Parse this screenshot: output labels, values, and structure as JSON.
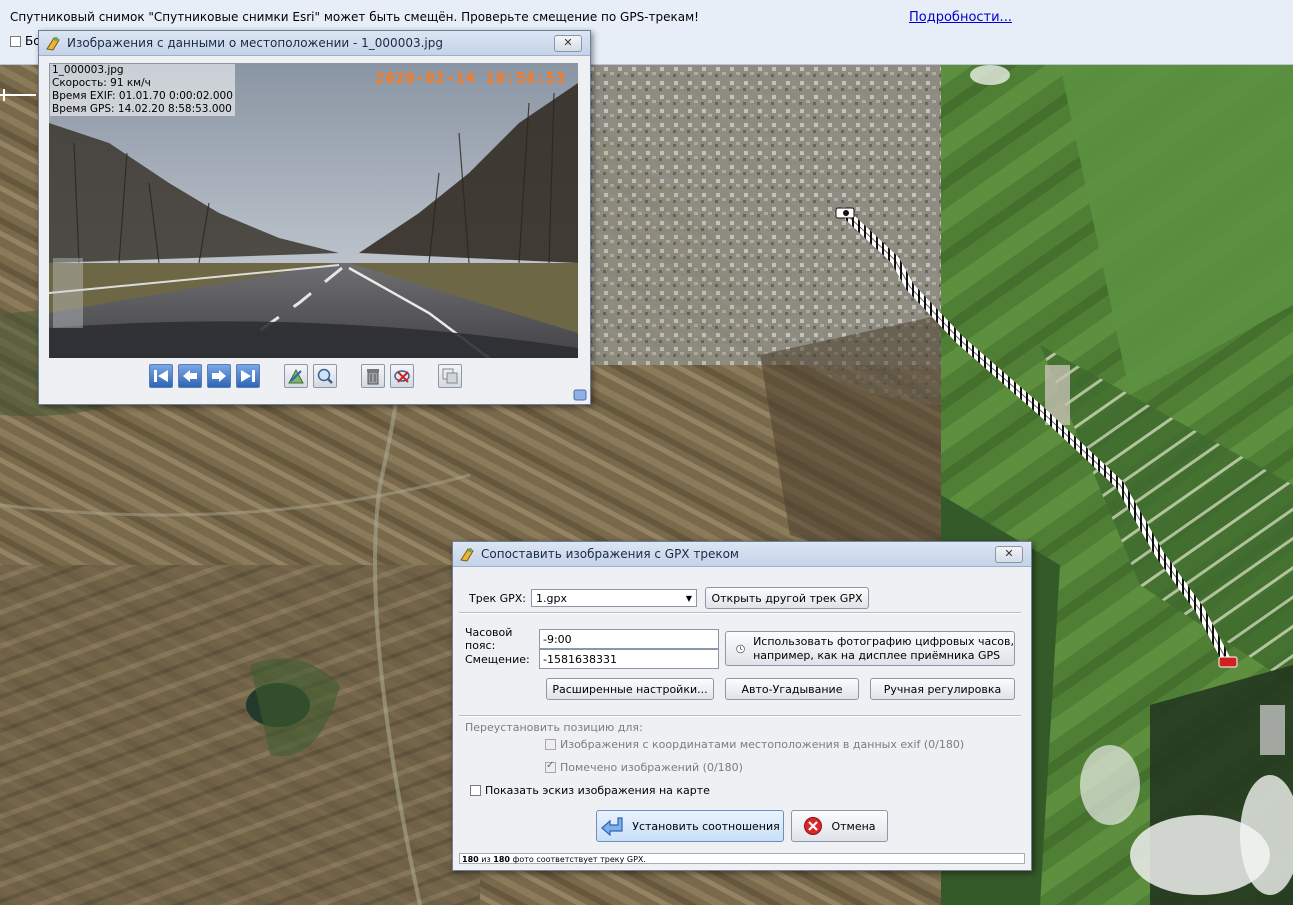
{
  "notice": {
    "message": "Спутниковый снимок \"Спутниковые снимки Esri\" может быть смещён. Проверьте смещение по GPS-трекам!",
    "link": "Подробности...",
    "checkbox_label": "Бо"
  },
  "viewer": {
    "title": "Изображения с данными о местоположении - 1_000003.jpg",
    "close_glyph": "✕",
    "info_filename": "1_000003.jpg",
    "info_speed": "Скорость: 91 км/ч",
    "info_exif_time": "Время EXIF: 01.01.70 0:00:02.000",
    "info_gps_time": "Время GPS: 14.02.20 8:58:53.000",
    "stamp": "2020-02-14 10:58:53"
  },
  "dialog": {
    "title": "Сопоставить изображения с GPX треком",
    "close_glyph": "✕",
    "gpx_label": "Трек GPX:",
    "gpx_value": "1.gpx",
    "open_other_gpx": "Открыть другой трек GPX",
    "timezone_label": "Часовой пояс:",
    "timezone_value": "-9:00",
    "offset_label": "Смещение:",
    "offset_value": "-1581638331",
    "use_photo_clock_line1": "Использовать фотографию цифровых часов,",
    "use_photo_clock_line2": "например, как на дисплее приёмника GPS",
    "advanced_settings": "Расширенные настройки...",
    "auto_guess": "Авто-Угадывание",
    "manual_adjust": "Ручная регулировка",
    "reposition_label": "Переустановить позицию для:",
    "exif_coords_option": "Изображения с координатами местоположения в данных exif (0/180)",
    "tagged_option": "Помечено изображений (0/180)",
    "show_thumbnail": "Показать эскиз изображения на карте",
    "apply_button": "Установить соотношения",
    "cancel_button": "Отмена",
    "status_count_a": "180",
    "status_mid": " из ",
    "status_count_b": "180",
    "status_tail": " фото соответствует треку GPX."
  },
  "colors": {
    "accent": "#2f64b6",
    "track_start": "#111111",
    "track_end": "#d21f1f",
    "stamp": "#ff7a1c",
    "link": "#0000cc"
  }
}
